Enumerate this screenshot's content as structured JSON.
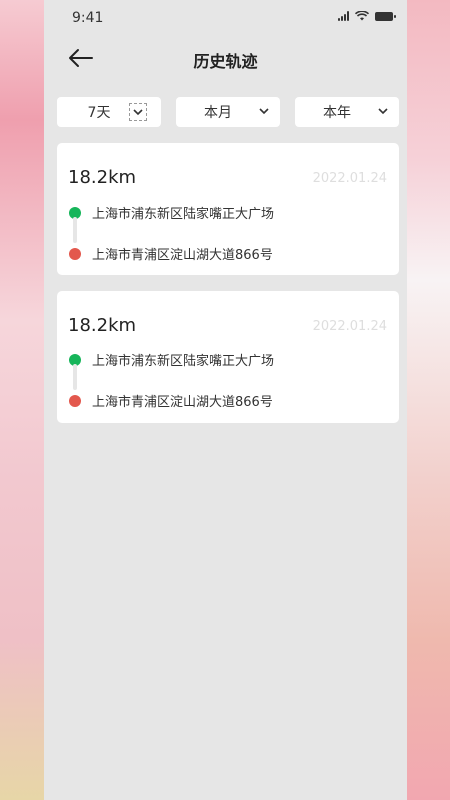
{
  "status_bar": {
    "time": "9:41"
  },
  "header": {
    "title": "历史轨迹"
  },
  "filters": [
    {
      "label": "7天"
    },
    {
      "label": "本月"
    },
    {
      "label": "本年"
    }
  ],
  "trips": [
    {
      "distance": "18.2km",
      "date": "2022.01.24",
      "start": "上海市浦东新区陆家嘴正大广场",
      "end": "上海市青浦区淀山湖大道866号"
    },
    {
      "distance": "18.2km",
      "date": "2022.01.24",
      "start": "上海市浦东新区陆家嘴正大广场",
      "end": "上海市青浦区淀山湖大道866号"
    }
  ],
  "colors": {
    "start_dot": "#16b55a",
    "end_dot": "#e3584d",
    "page_bg": "#e6e6e6"
  }
}
